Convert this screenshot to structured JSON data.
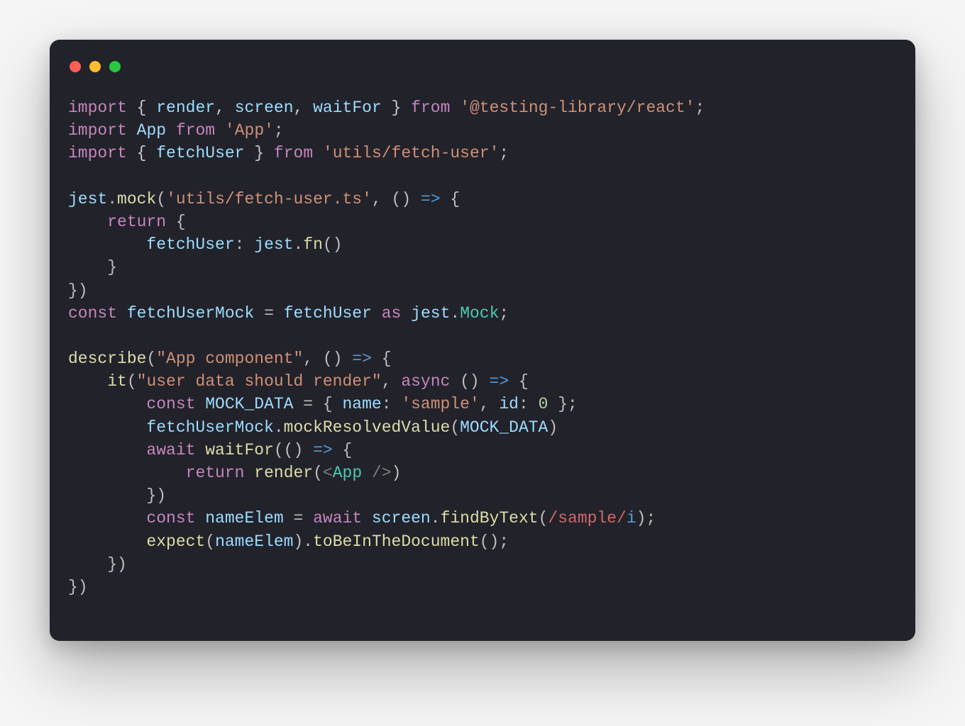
{
  "code": {
    "lines": [
      [
        {
          "t": "import",
          "c": "kw"
        },
        {
          "t": " { ",
          "c": "pale"
        },
        {
          "t": "render",
          "c": "obj"
        },
        {
          "t": ", ",
          "c": "pale"
        },
        {
          "t": "screen",
          "c": "obj"
        },
        {
          "t": ", ",
          "c": "pale"
        },
        {
          "t": "waitFor",
          "c": "obj"
        },
        {
          "t": " } ",
          "c": "pale"
        },
        {
          "t": "from",
          "c": "kw"
        },
        {
          "t": " ",
          "c": "id"
        },
        {
          "t": "'@testing-library/react'",
          "c": "str"
        },
        {
          "t": ";",
          "c": "id"
        }
      ],
      [
        {
          "t": "import",
          "c": "kw"
        },
        {
          "t": " ",
          "c": "id"
        },
        {
          "t": "App",
          "c": "obj"
        },
        {
          "t": " ",
          "c": "id"
        },
        {
          "t": "from",
          "c": "kw"
        },
        {
          "t": " ",
          "c": "id"
        },
        {
          "t": "'App'",
          "c": "str"
        },
        {
          "t": ";",
          "c": "id"
        }
      ],
      [
        {
          "t": "import",
          "c": "kw"
        },
        {
          "t": " { ",
          "c": "pale"
        },
        {
          "t": "fetchUser",
          "c": "obj"
        },
        {
          "t": " } ",
          "c": "pale"
        },
        {
          "t": "from",
          "c": "kw"
        },
        {
          "t": " ",
          "c": "id"
        },
        {
          "t": "'utils/fetch-user'",
          "c": "str"
        },
        {
          "t": ";",
          "c": "id"
        }
      ],
      [],
      [
        {
          "t": "jest",
          "c": "obj"
        },
        {
          "t": ".",
          "c": "id"
        },
        {
          "t": "mock",
          "c": "fn"
        },
        {
          "t": "(",
          "c": "id"
        },
        {
          "t": "'utils/fetch-user.ts'",
          "c": "str"
        },
        {
          "t": ", () ",
          "c": "id"
        },
        {
          "t": "=>",
          "c": "arrow"
        },
        {
          "t": " {",
          "c": "id"
        }
      ],
      [
        {
          "t": "    ",
          "c": "id"
        },
        {
          "t": "return",
          "c": "kw"
        },
        {
          "t": " {",
          "c": "id"
        }
      ],
      [
        {
          "t": "        ",
          "c": "id"
        },
        {
          "t": "fetchUser",
          "c": "obj"
        },
        {
          "t": ": ",
          "c": "id"
        },
        {
          "t": "jest",
          "c": "obj"
        },
        {
          "t": ".",
          "c": "id"
        },
        {
          "t": "fn",
          "c": "fn"
        },
        {
          "t": "()",
          "c": "id"
        }
      ],
      [
        {
          "t": "    }",
          "c": "id"
        }
      ],
      [
        {
          "t": "})",
          "c": "id"
        }
      ],
      [
        {
          "t": "const",
          "c": "kw"
        },
        {
          "t": " ",
          "c": "id"
        },
        {
          "t": "fetchUserMock",
          "c": "obj"
        },
        {
          "t": " = ",
          "c": "id"
        },
        {
          "t": "fetchUser",
          "c": "obj"
        },
        {
          "t": " ",
          "c": "id"
        },
        {
          "t": "as",
          "c": "kw"
        },
        {
          "t": " ",
          "c": "id"
        },
        {
          "t": "jest",
          "c": "obj"
        },
        {
          "t": ".",
          "c": "id"
        },
        {
          "t": "Mock",
          "c": "type"
        },
        {
          "t": ";",
          "c": "id"
        }
      ],
      [],
      [
        {
          "t": "describe",
          "c": "fn"
        },
        {
          "t": "(",
          "c": "id"
        },
        {
          "t": "\"App component\"",
          "c": "str"
        },
        {
          "t": ", () ",
          "c": "id"
        },
        {
          "t": "=>",
          "c": "arrow"
        },
        {
          "t": " {",
          "c": "id"
        }
      ],
      [
        {
          "t": "    ",
          "c": "id"
        },
        {
          "t": "it",
          "c": "fn"
        },
        {
          "t": "(",
          "c": "id"
        },
        {
          "t": "\"user data should render\"",
          "c": "str"
        },
        {
          "t": ", ",
          "c": "id"
        },
        {
          "t": "async",
          "c": "kw"
        },
        {
          "t": " () ",
          "c": "id"
        },
        {
          "t": "=>",
          "c": "arrow"
        },
        {
          "t": " {",
          "c": "id"
        }
      ],
      [
        {
          "t": "        ",
          "c": "id"
        },
        {
          "t": "const",
          "c": "kw"
        },
        {
          "t": " ",
          "c": "id"
        },
        {
          "t": "MOCK_DATA",
          "c": "obj"
        },
        {
          "t": " = { ",
          "c": "id"
        },
        {
          "t": "name",
          "c": "obj"
        },
        {
          "t": ": ",
          "c": "id"
        },
        {
          "t": "'sample'",
          "c": "str"
        },
        {
          "t": ", ",
          "c": "id"
        },
        {
          "t": "id",
          "c": "obj"
        },
        {
          "t": ": ",
          "c": "id"
        },
        {
          "t": "0",
          "c": "num"
        },
        {
          "t": " };",
          "c": "id"
        }
      ],
      [
        {
          "t": "        ",
          "c": "id"
        },
        {
          "t": "fetchUserMock",
          "c": "obj"
        },
        {
          "t": ".",
          "c": "id"
        },
        {
          "t": "mockResolvedValue",
          "c": "fn"
        },
        {
          "t": "(",
          "c": "id"
        },
        {
          "t": "MOCK_DATA",
          "c": "obj"
        },
        {
          "t": ")",
          "c": "id"
        }
      ],
      [
        {
          "t": "        ",
          "c": "id"
        },
        {
          "t": "await",
          "c": "kw"
        },
        {
          "t": " ",
          "c": "id"
        },
        {
          "t": "waitFor",
          "c": "fn"
        },
        {
          "t": "(() ",
          "c": "id"
        },
        {
          "t": "=>",
          "c": "arrow"
        },
        {
          "t": " {",
          "c": "id"
        }
      ],
      [
        {
          "t": "            ",
          "c": "id"
        },
        {
          "t": "return",
          "c": "kw"
        },
        {
          "t": " ",
          "c": "id"
        },
        {
          "t": "render",
          "c": "fn"
        },
        {
          "t": "(",
          "c": "id"
        },
        {
          "t": "<",
          "c": "tag"
        },
        {
          "t": "App",
          "c": "type"
        },
        {
          "t": " ",
          "c": "id"
        },
        {
          "t": "/>",
          "c": "tag"
        },
        {
          "t": ")",
          "c": "id"
        }
      ],
      [
        {
          "t": "        })",
          "c": "id"
        }
      ],
      [
        {
          "t": "        ",
          "c": "id"
        },
        {
          "t": "const",
          "c": "kw"
        },
        {
          "t": " ",
          "c": "id"
        },
        {
          "t": "nameElem",
          "c": "obj"
        },
        {
          "t": " = ",
          "c": "id"
        },
        {
          "t": "await",
          "c": "kw"
        },
        {
          "t": " ",
          "c": "id"
        },
        {
          "t": "screen",
          "c": "obj"
        },
        {
          "t": ".",
          "c": "id"
        },
        {
          "t": "findByText",
          "c": "fn"
        },
        {
          "t": "(",
          "c": "id"
        },
        {
          "t": "/sample/",
          "c": "re"
        },
        {
          "t": "i",
          "c": "refl"
        },
        {
          "t": ");",
          "c": "id"
        }
      ],
      [
        {
          "t": "        ",
          "c": "id"
        },
        {
          "t": "expect",
          "c": "fn"
        },
        {
          "t": "(",
          "c": "id"
        },
        {
          "t": "nameElem",
          "c": "obj"
        },
        {
          "t": ").",
          "c": "id"
        },
        {
          "t": "toBeInTheDocument",
          "c": "fn"
        },
        {
          "t": "();",
          "c": "id"
        }
      ],
      [
        {
          "t": "    })",
          "c": "id"
        }
      ],
      [
        {
          "t": "})",
          "c": "id"
        }
      ]
    ]
  },
  "colors": {
    "window_bg": "#22222a",
    "page_bg": "#f5f5f5",
    "red": "#ff5f56",
    "yellow": "#ffbd2e",
    "green": "#27c93f"
  }
}
